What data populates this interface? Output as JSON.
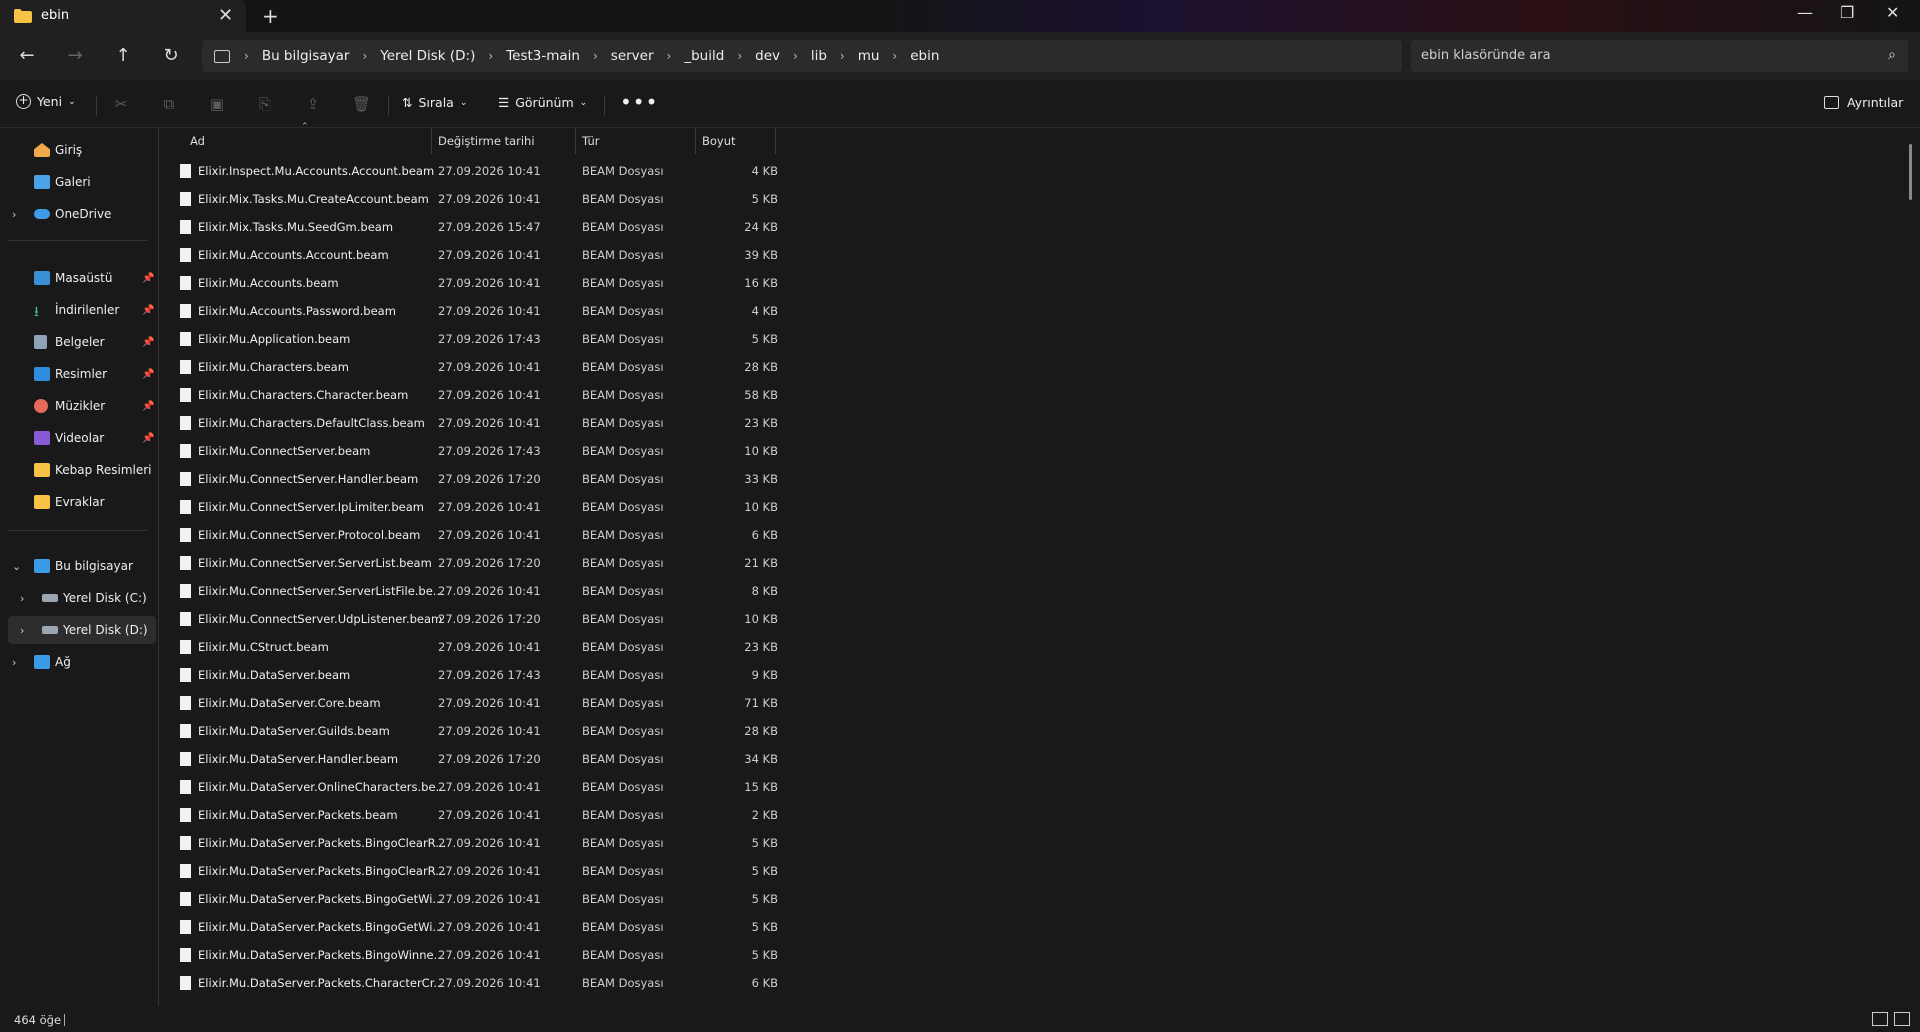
{
  "window": {
    "tab_title": "ebin",
    "new_tab": "+",
    "minimize": "—",
    "maximize": "❐",
    "close": "✕"
  },
  "address": {
    "crumbs": [
      "Bu bilgisayar",
      "Yerel Disk (D:)",
      "Test3-main",
      "server",
      "_build",
      "dev",
      "lib",
      "mu",
      "ebin"
    ],
    "search_placeholder": "ebin klasöründe ara"
  },
  "toolbar": {
    "new_label": "Yeni",
    "sort_label": "Sırala",
    "view_label": "Görünüm",
    "more_label": "•••",
    "details_label": "Ayrıntılar"
  },
  "sidebar": {
    "items": [
      {
        "label": "Giriş",
        "icon": "home-icon"
      },
      {
        "label": "Galeri",
        "icon": "gallery-icon"
      },
      {
        "label": "OneDrive",
        "icon": "cloud-icon"
      },
      {
        "label": "Masaüstü",
        "icon": "desktop-icon"
      },
      {
        "label": "İndirilenler",
        "icon": "download-icon"
      },
      {
        "label": "Belgeler",
        "icon": "documents-icon"
      },
      {
        "label": "Resimler",
        "icon": "pictures-icon"
      },
      {
        "label": "Müzikler",
        "icon": "music-icon"
      },
      {
        "label": "Videolar",
        "icon": "videos-icon"
      },
      {
        "label": "Kebap Resimleri",
        "icon": "folder-icon"
      },
      {
        "label": "Evraklar",
        "icon": "folder-icon"
      },
      {
        "label": "Bu bilgisayar",
        "icon": "computer-icon"
      },
      {
        "label": "Yerel Disk (C:)",
        "icon": "drive-icon"
      },
      {
        "label": "Yerel Disk (D:)",
        "icon": "drive-icon"
      },
      {
        "label": "Ağ",
        "icon": "network-icon"
      }
    ]
  },
  "columns": {
    "name": "Ad",
    "date": "Değiştirme tarihi",
    "type": "Tür",
    "size": "Boyut"
  },
  "files": [
    {
      "name": "Elixir.Inspect.Mu.Accounts.Account.beam",
      "date": "27.09.2026 10:41",
      "type": "BEAM Dosyası",
      "size": "4 KB"
    },
    {
      "name": "Elixir.Mix.Tasks.Mu.CreateAccount.beam",
      "date": "27.09.2026 10:41",
      "type": "BEAM Dosyası",
      "size": "5 KB"
    },
    {
      "name": "Elixir.Mix.Tasks.Mu.SeedGm.beam",
      "date": "27.09.2026 15:47",
      "type": "BEAM Dosyası",
      "size": "24 KB"
    },
    {
      "name": "Elixir.Mu.Accounts.Account.beam",
      "date": "27.09.2026 10:41",
      "type": "BEAM Dosyası",
      "size": "39 KB"
    },
    {
      "name": "Elixir.Mu.Accounts.beam",
      "date": "27.09.2026 10:41",
      "type": "BEAM Dosyası",
      "size": "16 KB"
    },
    {
      "name": "Elixir.Mu.Accounts.Password.beam",
      "date": "27.09.2026 10:41",
      "type": "BEAM Dosyası",
      "size": "4 KB"
    },
    {
      "name": "Elixir.Mu.Application.beam",
      "date": "27.09.2026 17:43",
      "type": "BEAM Dosyası",
      "size": "5 KB"
    },
    {
      "name": "Elixir.Mu.Characters.beam",
      "date": "27.09.2026 10:41",
      "type": "BEAM Dosyası",
      "size": "28 KB"
    },
    {
      "name": "Elixir.Mu.Characters.Character.beam",
      "date": "27.09.2026 10:41",
      "type": "BEAM Dosyası",
      "size": "58 KB"
    },
    {
      "name": "Elixir.Mu.Characters.DefaultClass.beam",
      "date": "27.09.2026 10:41",
      "type": "BEAM Dosyası",
      "size": "23 KB"
    },
    {
      "name": "Elixir.Mu.ConnectServer.beam",
      "date": "27.09.2026 17:43",
      "type": "BEAM Dosyası",
      "size": "10 KB"
    },
    {
      "name": "Elixir.Mu.ConnectServer.Handler.beam",
      "date": "27.09.2026 17:20",
      "type": "BEAM Dosyası",
      "size": "33 KB"
    },
    {
      "name": "Elixir.Mu.ConnectServer.IpLimiter.beam",
      "date": "27.09.2026 10:41",
      "type": "BEAM Dosyası",
      "size": "10 KB"
    },
    {
      "name": "Elixir.Mu.ConnectServer.Protocol.beam",
      "date": "27.09.2026 10:41",
      "type": "BEAM Dosyası",
      "size": "6 KB"
    },
    {
      "name": "Elixir.Mu.ConnectServer.ServerList.beam",
      "date": "27.09.2026 17:20",
      "type": "BEAM Dosyası",
      "size": "21 KB"
    },
    {
      "name": "Elixir.Mu.ConnectServer.ServerListFile.be...",
      "date": "27.09.2026 10:41",
      "type": "BEAM Dosyası",
      "size": "8 KB"
    },
    {
      "name": "Elixir.Mu.ConnectServer.UdpListener.beam",
      "date": "27.09.2026 17:20",
      "type": "BEAM Dosyası",
      "size": "10 KB"
    },
    {
      "name": "Elixir.Mu.CStruct.beam",
      "date": "27.09.2026 10:41",
      "type": "BEAM Dosyası",
      "size": "23 KB"
    },
    {
      "name": "Elixir.Mu.DataServer.beam",
      "date": "27.09.2026 17:43",
      "type": "BEAM Dosyası",
      "size": "9 KB"
    },
    {
      "name": "Elixir.Mu.DataServer.Core.beam",
      "date": "27.09.2026 10:41",
      "type": "BEAM Dosyası",
      "size": "71 KB"
    },
    {
      "name": "Elixir.Mu.DataServer.Guilds.beam",
      "date": "27.09.2026 10:41",
      "type": "BEAM Dosyası",
      "size": "28 KB"
    },
    {
      "name": "Elixir.Mu.DataServer.Handler.beam",
      "date": "27.09.2026 17:20",
      "type": "BEAM Dosyası",
      "size": "34 KB"
    },
    {
      "name": "Elixir.Mu.DataServer.OnlineCharacters.be...",
      "date": "27.09.2026 10:41",
      "type": "BEAM Dosyası",
      "size": "15 KB"
    },
    {
      "name": "Elixir.Mu.DataServer.Packets.beam",
      "date": "27.09.2026 10:41",
      "type": "BEAM Dosyası",
      "size": "2 KB"
    },
    {
      "name": "Elixir.Mu.DataServer.Packets.BingoClearR...",
      "date": "27.09.2026 10:41",
      "type": "BEAM Dosyası",
      "size": "5 KB"
    },
    {
      "name": "Elixir.Mu.DataServer.Packets.BingoClearR...",
      "date": "27.09.2026 10:41",
      "type": "BEAM Dosyası",
      "size": "5 KB"
    },
    {
      "name": "Elixir.Mu.DataServer.Packets.BingoGetWi...",
      "date": "27.09.2026 10:41",
      "type": "BEAM Dosyası",
      "size": "5 KB"
    },
    {
      "name": "Elixir.Mu.DataServer.Packets.BingoGetWi...",
      "date": "27.09.2026 10:41",
      "type": "BEAM Dosyası",
      "size": "5 KB"
    },
    {
      "name": "Elixir.Mu.DataServer.Packets.BingoWinne...",
      "date": "27.09.2026 10:41",
      "type": "BEAM Dosyası",
      "size": "5 KB"
    },
    {
      "name": "Elixir.Mu.DataServer.Packets.CharacterCr...",
      "date": "27.09.2026 10:41",
      "type": "BEAM Dosyası",
      "size": "6 KB"
    }
  ],
  "status": {
    "count": "464 öğe"
  },
  "colors": {
    "background": "#191919",
    "bar": "#202020",
    "field": "#2b2b2b",
    "folder": "#f6c344"
  }
}
